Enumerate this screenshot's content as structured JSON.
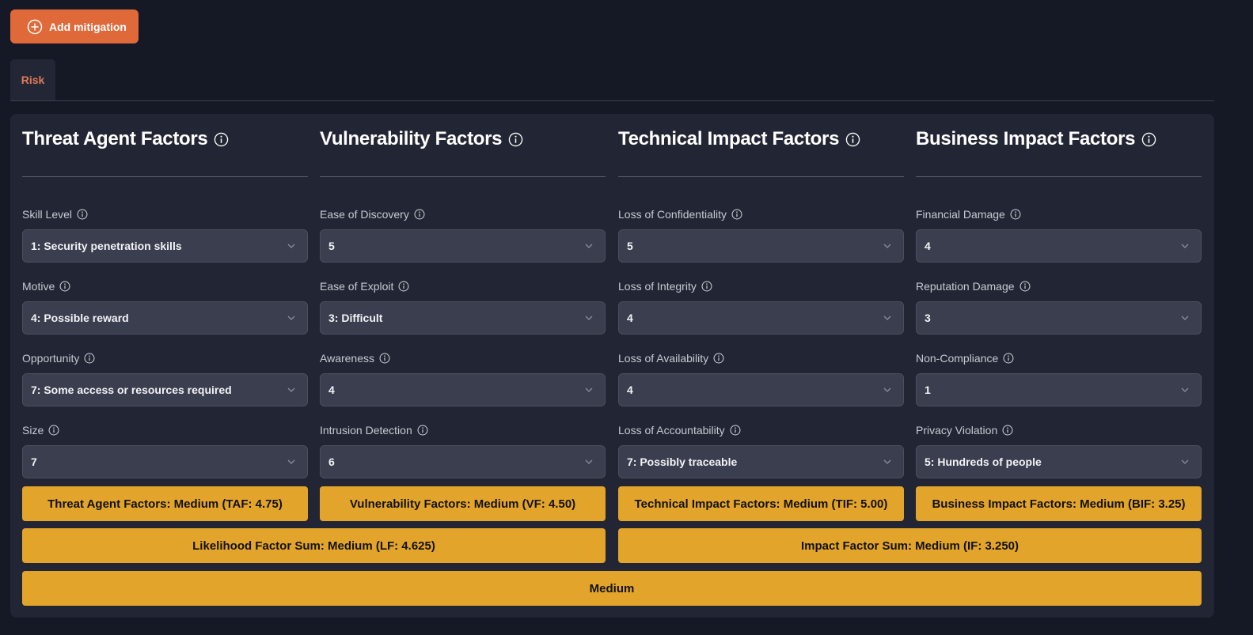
{
  "toolbar": {
    "add_mitigation_label": "Add mitigation"
  },
  "tabs": [
    {
      "label": "Risk",
      "active": true
    }
  ],
  "colors": {
    "accent": "#e0693a",
    "risk_medium": "#e3a42b",
    "tab_active_text": "#e07a55"
  },
  "columns": [
    {
      "title": "Threat Agent Factors",
      "fields": [
        {
          "label": "Skill Level",
          "value": "1: Security penetration skills"
        },
        {
          "label": "Motive",
          "value": "4: Possible reward"
        },
        {
          "label": "Opportunity",
          "value": "7: Some access or resources required"
        },
        {
          "label": "Size",
          "value": "7"
        }
      ],
      "summary": "Threat Agent Factors: Medium (TAF: 4.75)"
    },
    {
      "title": "Vulnerability Factors",
      "fields": [
        {
          "label": "Ease of Discovery",
          "value": "5"
        },
        {
          "label": "Ease of Exploit",
          "value": "3: Difficult"
        },
        {
          "label": "Awareness",
          "value": "4"
        },
        {
          "label": "Intrusion Detection",
          "value": "6"
        }
      ],
      "summary": "Vulnerability Factors: Medium (VF: 4.50)"
    },
    {
      "title": "Technical Impact Factors",
      "fields": [
        {
          "label": "Loss of Confidentiality",
          "value": "5"
        },
        {
          "label": "Loss of Integrity",
          "value": "4"
        },
        {
          "label": "Loss of Availability",
          "value": "4"
        },
        {
          "label": "Loss of Accountability",
          "value": "7: Possibly traceable"
        }
      ],
      "summary": "Technical Impact Factors: Medium (TIF: 5.00)"
    },
    {
      "title": "Business Impact Factors",
      "fields": [
        {
          "label": "Financial Damage",
          "value": "4"
        },
        {
          "label": "Reputation Damage",
          "value": "3"
        },
        {
          "label": "Non-Compliance",
          "value": "1"
        },
        {
          "label": "Privacy Violation",
          "value": "5: Hundreds of people"
        }
      ],
      "summary": "Business Impact Factors: Medium (BIF: 3.25)"
    }
  ],
  "totals": {
    "likelihood": "Likelihood Factor Sum: Medium (LF: 4.625)",
    "impact": "Impact Factor Sum: Medium (IF: 3.250)",
    "overall": "Medium"
  }
}
